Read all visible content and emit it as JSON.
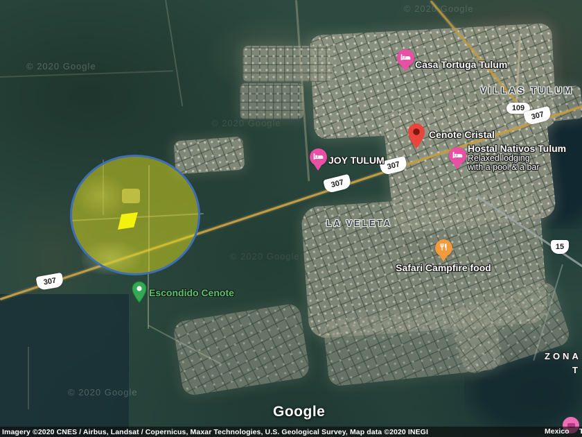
{
  "colors": {
    "highlight_circle_fill": "#d8d81c",
    "highlight_circle_border": "#3f6fb2",
    "parcel_yellow": "#f2f20c",
    "lodging_pink": "#e850a5",
    "place_red": "#e8453c",
    "cenote_green": "#34a853",
    "food_orange": "#f09c3c",
    "road_yellow": "#c49b40"
  },
  "watermarks": [
    {
      "text": "© 2020 Google"
    },
    {
      "text": "© 2020 Google"
    },
    {
      "text": "© 2020 Google"
    },
    {
      "text": "© 2020 Google"
    },
    {
      "text": "© 2020 Google"
    }
  ],
  "area_labels": {
    "villas_tulum": "VILLAS TULUM",
    "la_veleta": "LA VELETA",
    "zona": "ZONA",
    "zona_cont": "T"
  },
  "markers": {
    "casa_tortuga": {
      "label": "Casa Tortuga Tulum",
      "type": "lodging"
    },
    "cenote_cristal": {
      "label": "Cenote Cristal",
      "type": "place"
    },
    "joy_tulum": {
      "label": "JOY TULUM",
      "type": "lodging"
    },
    "hostal_nativos": {
      "label": "Hostal Nativos Tulum",
      "description_line1": "Relaxed lodging",
      "description_line2": "with a pool & a bar",
      "type": "lodging"
    },
    "safari_campfire": {
      "label": "Safari Campfire food",
      "type": "restaurant"
    },
    "escondido_cenote": {
      "label": "Escondido Cenote",
      "type": "cenote"
    }
  },
  "route_shields": {
    "r109": "109",
    "r307_ne": "307",
    "r307_mid1": "307",
    "r307_mid2": "307",
    "r307_sw": "307",
    "r15": "15"
  },
  "footer": {
    "logo": "Google",
    "attribution": "Imagery ©2020 CNES / Airbus, Landsat / Copernicus, Maxar Technologies, U.S. Geological Survey, Map data ©2020 INEGI",
    "country": "Mexico",
    "terms_partial": "T"
  }
}
